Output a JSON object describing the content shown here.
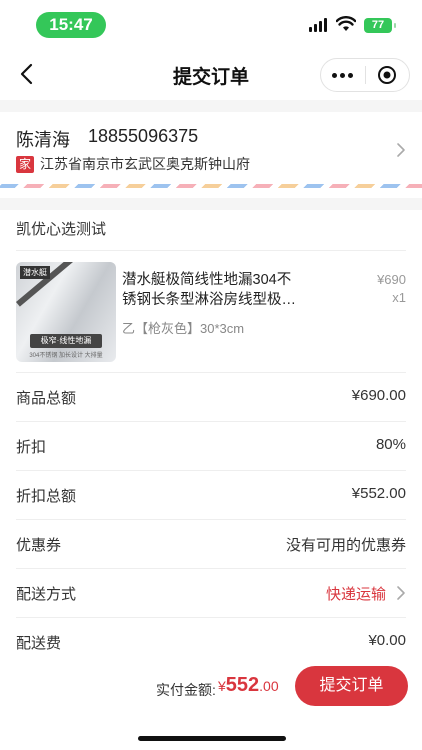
{
  "status": {
    "time": "15:47",
    "battery": "77"
  },
  "nav": {
    "title": "提交订单"
  },
  "address": {
    "name": "陈清海",
    "phone": "18855096375",
    "tag": "家",
    "detail": "江苏省南京市玄武区奥克斯钟山府"
  },
  "shop": {
    "name": "凯优心选测试"
  },
  "product": {
    "title": "潜水艇极简线性地漏304不锈钢长条型淋浴房线型极…",
    "spec": "乙【枪灰色】30*3cm",
    "price": "¥690",
    "qty": "x1",
    "image_text": {
      "brand": "潜水艇",
      "banner": "极窄·线性地漏",
      "sub": "304不锈钢 加长设计 大排量"
    }
  },
  "summary": [
    {
      "label": "商品总额",
      "value": "¥690.00"
    },
    {
      "label": "折扣",
      "value": "80%"
    },
    {
      "label": "折扣总额",
      "value": "¥552.00"
    },
    {
      "label": "优惠券",
      "value": "没有可用的优惠券"
    },
    {
      "label": "配送方式",
      "value": "快递运输"
    },
    {
      "label": "配送费",
      "value": "¥0.00"
    }
  ],
  "footer": {
    "pay_label": "实付金额:",
    "currency": "¥",
    "amount_int": "552",
    "amount_dec": ".00",
    "submit_label": "提交订单"
  },
  "colors": {
    "accent": "#d9363e",
    "status_green": "#34c759"
  }
}
